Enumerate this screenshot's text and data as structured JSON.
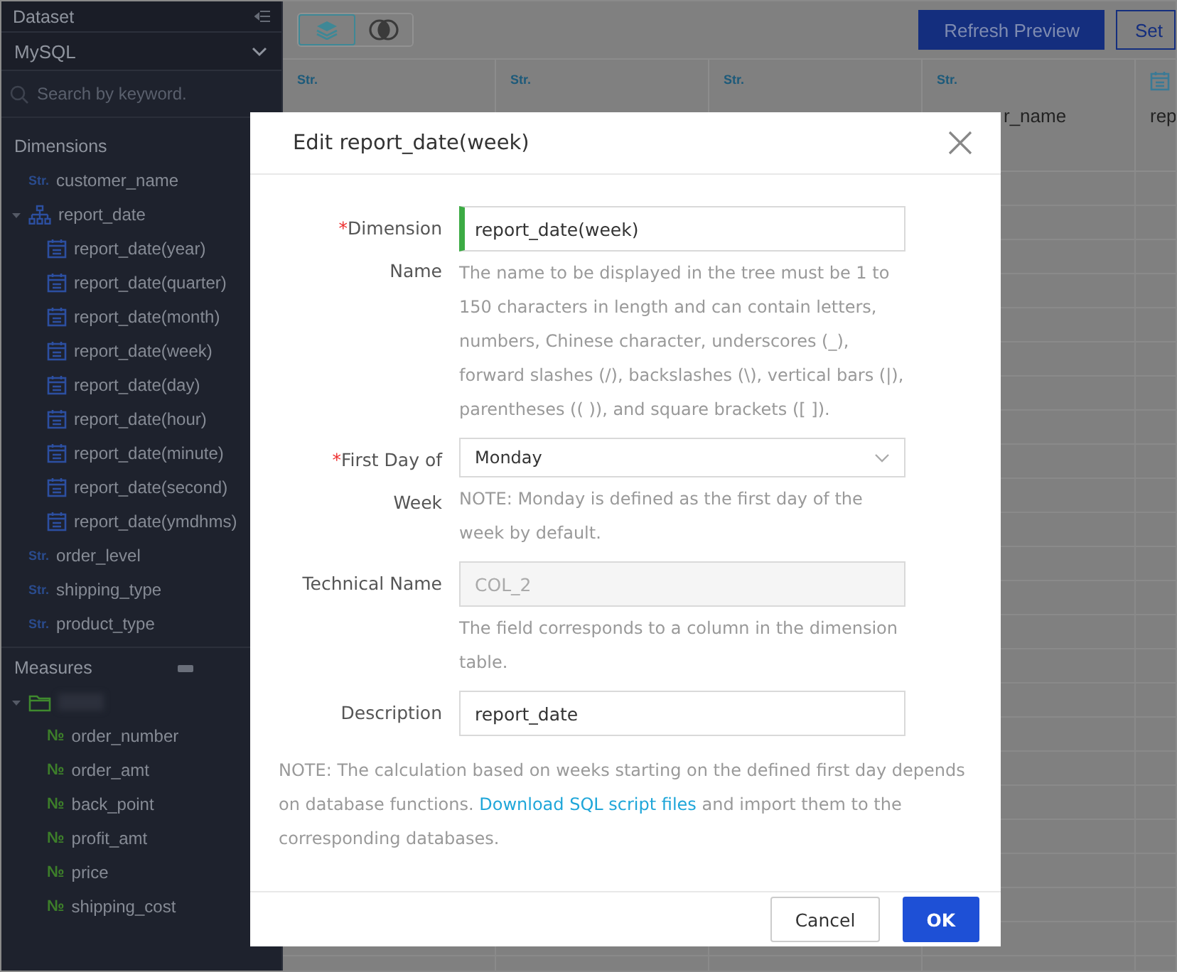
{
  "sidebar": {
    "title": "Dataset",
    "dataset": "MySQL",
    "search": {
      "placeholder": "Search by keyword."
    },
    "dimensions": {
      "title": "Dimensions",
      "items": [
        {
          "kind": "string",
          "tag": "Str.",
          "label": "customer_name"
        },
        {
          "kind": "hierarchy",
          "label": "report_date",
          "expanded": true,
          "children": [
            {
              "kind": "date",
              "label": "report_date(year)"
            },
            {
              "kind": "date",
              "label": "report_date(quarter)"
            },
            {
              "kind": "date",
              "label": "report_date(month)"
            },
            {
              "kind": "date",
              "label": "report_date(week)"
            },
            {
              "kind": "date",
              "label": "report_date(day)"
            },
            {
              "kind": "date",
              "label": "report_date(hour)"
            },
            {
              "kind": "date",
              "label": "report_date(minute)"
            },
            {
              "kind": "date",
              "label": "report_date(second)"
            },
            {
              "kind": "date",
              "label": "report_date(ymdhms)"
            }
          ]
        },
        {
          "kind": "string",
          "tag": "Str.",
          "label": "order_level"
        },
        {
          "kind": "string",
          "tag": "Str.",
          "label": "shipping_type"
        },
        {
          "kind": "string",
          "tag": "Str.",
          "label": "product_type"
        }
      ]
    },
    "measures": {
      "title": "Measures",
      "items": [
        {
          "kind": "folder",
          "expanded": true,
          "children": [
            {
              "kind": "number",
              "tag": "№",
              "label": "order_number"
            },
            {
              "kind": "number",
              "tag": "№",
              "label": "order_amt"
            },
            {
              "kind": "number",
              "tag": "№",
              "label": "back_point"
            },
            {
              "kind": "number",
              "tag": "№",
              "label": "profit_amt"
            },
            {
              "kind": "number",
              "tag": "№",
              "label": "price"
            },
            {
              "kind": "number",
              "tag": "№",
              "label": "shipping_cost"
            }
          ]
        }
      ]
    }
  },
  "toolbar": {
    "view_toggles": [
      {
        "kind": "layers",
        "selected": true
      },
      {
        "kind": "circles",
        "selected": false
      }
    ],
    "buttons": [
      {
        "label": "Refresh Preview",
        "kind": "primary"
      },
      {
        "label": "Set",
        "kind": "outline"
      }
    ]
  },
  "table": {
    "columns": [
      {
        "kind": "string",
        "tag": "Str."
      },
      {
        "kind": "string",
        "tag": "Str."
      },
      {
        "kind": "string",
        "tag": "Str."
      },
      {
        "kind": "string",
        "tag": "Str.",
        "label": "r_name"
      },
      {
        "kind": "date",
        "label": "rep"
      }
    ]
  },
  "dialog": {
    "title": "Edit report_date(week)",
    "fields": [
      {
        "kind": "text",
        "required_mark": "*",
        "label": "Dimension Name",
        "value": "report_date(week)",
        "focused": true,
        "disabled": false,
        "help": "The name to be displayed in the tree must be 1 to 150 characters in length and can contain letters, numbers, Chinese character, underscores (_), forward slashes (/), backslashes (\\), vertical bars (|), parentheses (( )), and square brackets ([ ])."
      },
      {
        "kind": "select",
        "required_mark": "*",
        "label": "First Day of Week",
        "value": "Monday",
        "focused": false,
        "disabled": false,
        "help": "NOTE: Monday is defined as the first day of the week by default."
      },
      {
        "kind": "text",
        "label": "Technical Name",
        "value": "COL_2",
        "focused": false,
        "disabled": true,
        "help": "The field corresponds to a column in the dimension table."
      },
      {
        "kind": "text",
        "label": "Description",
        "value": "report_date",
        "focused": false,
        "disabled": false
      }
    ],
    "note": {
      "before": "NOTE: The calculation based on weeks starting on the defined first day depends on database functions.",
      "link": "Download SQL script files",
      "after": "and import them to the corresponding databases."
    },
    "buttons": [
      {
        "label": "Cancel",
        "kind": "secondary"
      },
      {
        "label": "OK",
        "kind": "primary"
      }
    ]
  }
}
